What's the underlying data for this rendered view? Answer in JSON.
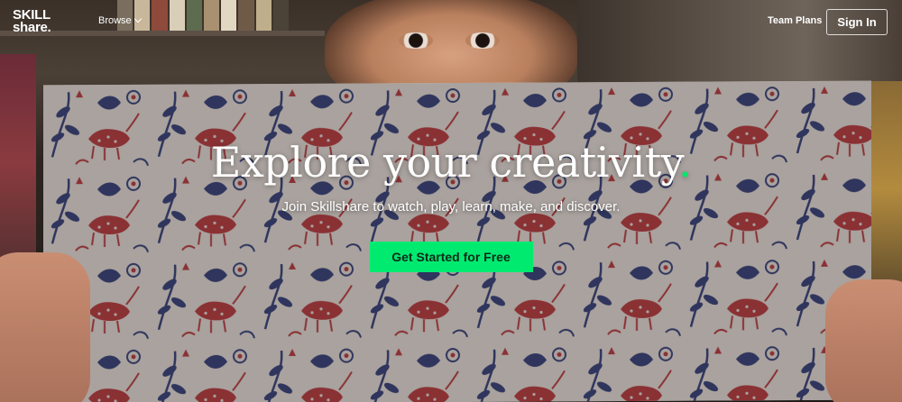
{
  "brand": {
    "logo_line1": "SKILL",
    "logo_line2": "share."
  },
  "nav": {
    "browse_label": "Browse",
    "team_plans_label": "Team Plans",
    "sign_in_label": "Sign In"
  },
  "hero": {
    "title": "Explore your creativity",
    "title_dot": ".",
    "subtitle": "Join Skillshare to watch, play, learn, make, and discover.",
    "cta_label": "Get Started for Free"
  },
  "colors": {
    "accent": "#00ea70",
    "title_dot": "#00e66b",
    "pattern_navy": "#2a3a78",
    "pattern_red": "#b3343a"
  },
  "icons": {
    "browse_dropdown": "chevron-down-icon"
  }
}
